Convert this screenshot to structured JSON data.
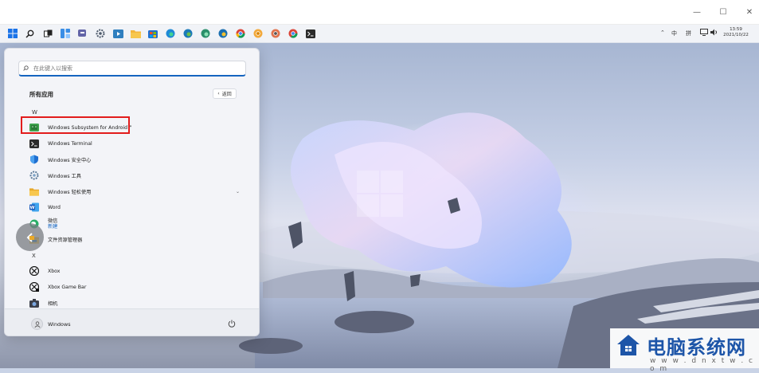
{
  "window": {
    "minimize": "—",
    "maximize": "☐",
    "close": "✕"
  },
  "taskbar": {
    "icons": [
      "windows-start",
      "search",
      "task-view",
      "widgets",
      "teams-chat",
      "settings",
      "media-player",
      "file-explorer",
      "store",
      "edge",
      "edge-beta",
      "edge-dev",
      "edge-canary",
      "chrome",
      "chrome-beta",
      "chrome-canary",
      "chrome-dev",
      "terminal"
    ],
    "tray": {
      "chevron": "⌃",
      "ime_mode": "中",
      "ime_pinyin": "拼",
      "time": "13:59",
      "date": "2021/10/22"
    }
  },
  "start_menu": {
    "search_placeholder": "在此键入以搜索",
    "all_apps_title": "所有应用",
    "back_label": "返回",
    "sections": [
      {
        "letter": "W",
        "apps": [
          {
            "name": "Windows Subsystem for Android™",
            "icon": "android-subsystem-icon"
          },
          {
            "name": "Windows Terminal",
            "icon": "terminal-icon"
          },
          {
            "name": "Windows 安全中心",
            "icon": "shield-icon"
          },
          {
            "name": "Windows 工具",
            "icon": "tools-icon"
          },
          {
            "name": "Windows 轻松使用",
            "icon": "folder-icon",
            "expandable": true
          },
          {
            "name": "Word",
            "icon": "word-icon"
          },
          {
            "name": "微信",
            "sub": "新建",
            "icon": "wechat-icon"
          },
          {
            "name": "文件资源管理器",
            "icon": "file-explorer-icon"
          }
        ]
      },
      {
        "letter": "X",
        "apps": [
          {
            "name": "Xbox",
            "icon": "xbox-icon"
          },
          {
            "name": "Xbox Game Bar",
            "icon": "xbox-game-bar-icon"
          },
          {
            "name": "相机",
            "icon": "camera-icon"
          }
        ]
      }
    ],
    "user_name": "Windows"
  },
  "watermark": {
    "title": "电脑系统网",
    "url": "w w w . d n x t w . c o m"
  },
  "colors": {
    "accent": "#1565c0",
    "highlight_box": "#e21c1c",
    "watermark_blue": "#1d55a8"
  }
}
